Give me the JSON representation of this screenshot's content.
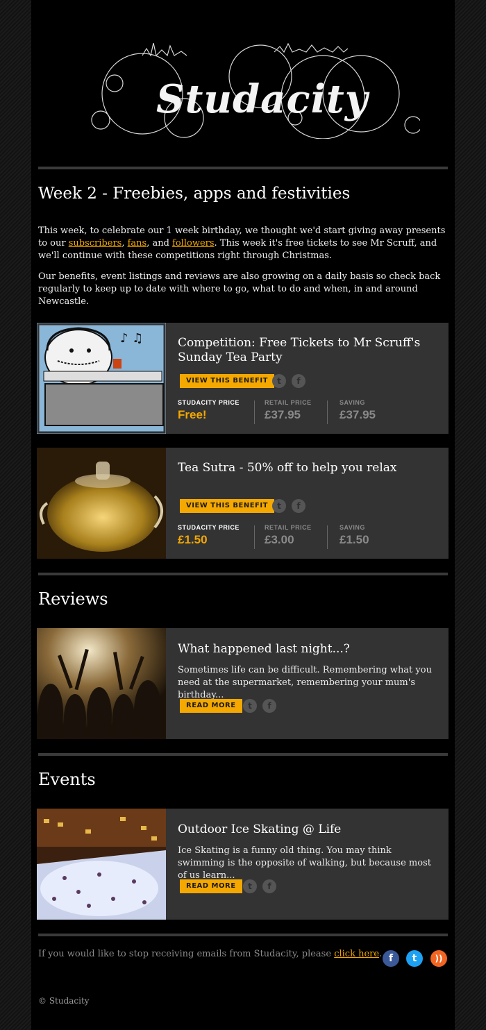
{
  "header": {
    "logo_text": "Studacity"
  },
  "intro": {
    "heading": "Week 2 - Freebies, apps and festivities",
    "p1_before": "This week, to celebrate our 1 week birthday, we thought we'd start giving away presents to our ",
    "link_subscribers": "subscribers",
    "sep1": ", ",
    "link_fans": "fans",
    "sep2": ", and ",
    "link_followers": "followers",
    "p1_after": ".  This week it's free tickets to see Mr Scruff, and we'll continue with these competitions right through Christmas.",
    "p2": "Our benefits, event listings and reviews are also growing on a daily basis so check back regularly to keep up to date with where to go, what to do and when, in and around Newcastle."
  },
  "benefits": [
    {
      "title": "Competition: Free Tickets to Mr Scruff's Sunday Tea Party",
      "button": "VIEW THIS BENEFIT",
      "price_label": "STUDACITY PRICE",
      "price": "Free!",
      "retail_label": "RETAIL PRICE",
      "retail": "£37.95",
      "saving_label": "SAVING",
      "saving": "£37.95"
    },
    {
      "title": "Tea Sutra - 50% off to help you relax",
      "button": "VIEW THIS BENEFIT",
      "price_label": "STUDACITY PRICE",
      "price": "£1.50",
      "retail_label": "RETAIL PRICE",
      "retail": "£3.00",
      "saving_label": "SAVING",
      "saving": "£1.50"
    }
  ],
  "reviews": {
    "heading": "Reviews",
    "items": [
      {
        "title": "What happened last night...?",
        "excerpt": "Sometimes life can be difficult. Remembering what you need at the supermarket, remembering your mum's birthday...",
        "button": "READ MORE"
      }
    ]
  },
  "events": {
    "heading": "Events",
    "items": [
      {
        "title": "Outdoor Ice Skating @ Life",
        "excerpt": "Ice Skating is a funny old thing. You may think swimming is the opposite of walking, but because most of us learn...",
        "button": "READ MORE"
      }
    ]
  },
  "footer": {
    "unsubscribe_before": "If you would like to stop receiving emails from Studacity, please ",
    "unsubscribe_link": "click here",
    "unsubscribe_after": ".",
    "copyright": "© Studacity",
    "social_icons": [
      "facebook-icon",
      "twitter-icon",
      "rss-icon"
    ]
  },
  "colors": {
    "accent": "#f4a800",
    "card_bg": "#333333",
    "page_bg": "#000000",
    "facebook": "#3b5998",
    "twitter": "#1da1f2",
    "rss": "#f26522"
  }
}
